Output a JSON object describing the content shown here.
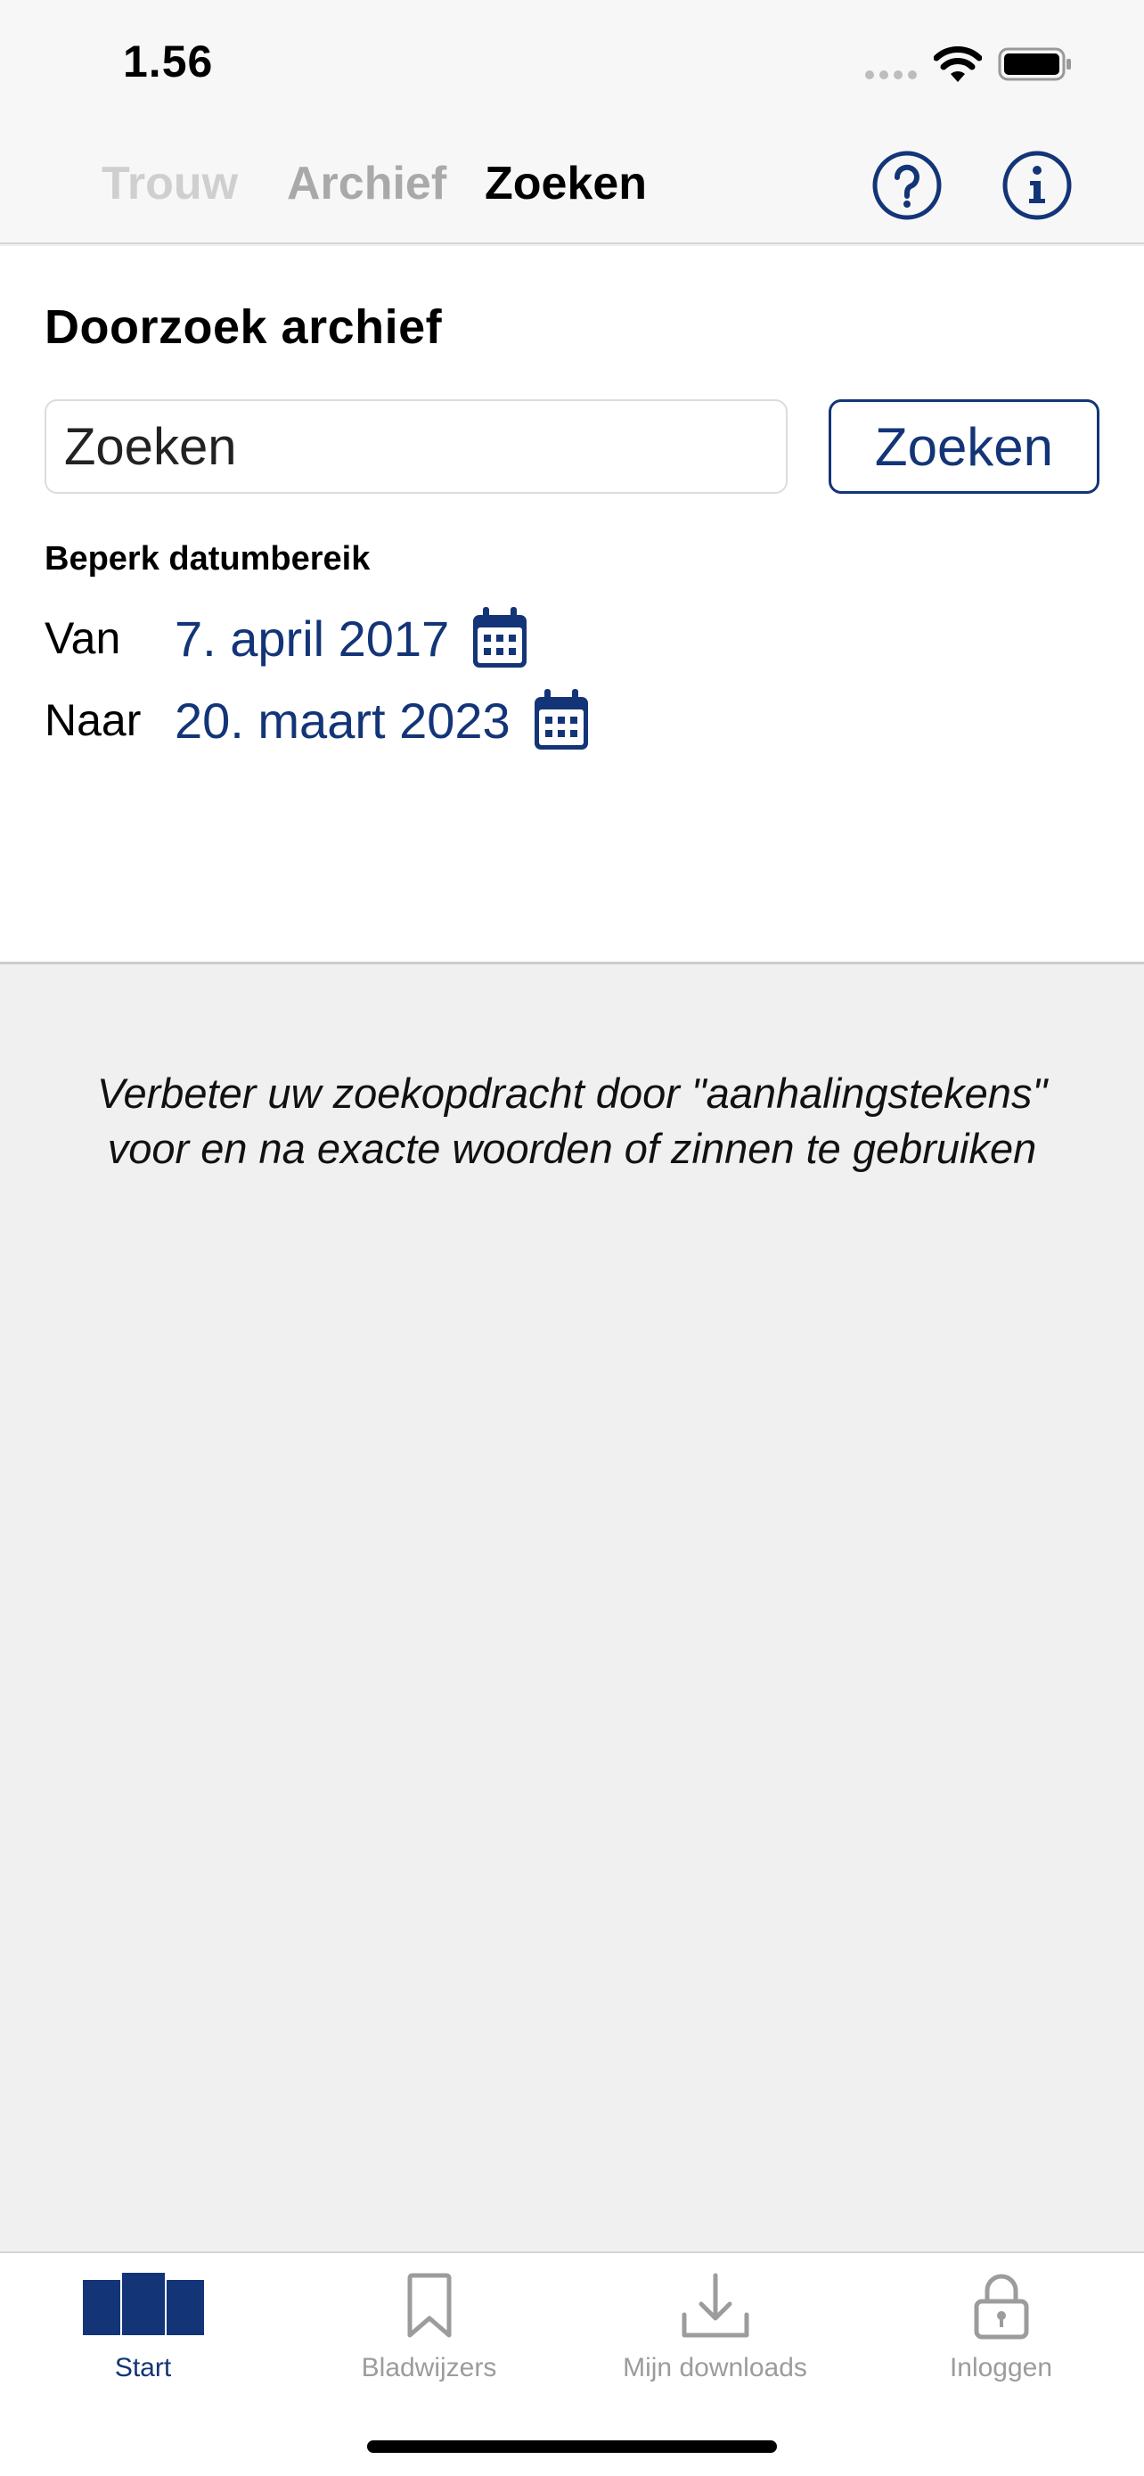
{
  "status_bar": {
    "time": "1.56"
  },
  "top_nav": {
    "tabs": [
      {
        "label": "Trouw"
      },
      {
        "label": "Archief"
      },
      {
        "label": "Zoeken"
      }
    ],
    "active_tab": "Zoeken",
    "actions": [
      "help-icon",
      "info-icon"
    ]
  },
  "search_panel": {
    "title": "Doorzoek archief",
    "input_placeholder": "Zoeken",
    "input_value": "",
    "button_label": "Zoeken",
    "range_label": "Beperk datumbereik",
    "from_label": "Van",
    "from_date": "7. april 2017",
    "to_label": "Naar",
    "to_date": "20. maart 2023"
  },
  "tip": {
    "line1": "Verbeter uw zoekopdracht door \"aanhalingstekens\"",
    "line2": "voor en na exacte woorden of zinnen te gebruiken"
  },
  "bottom_tabs": {
    "items": [
      {
        "label": "Start",
        "icon": "pages-icon"
      },
      {
        "label": "Bladwijzers",
        "icon": "bookmark-icon"
      },
      {
        "label": "Mijn downloads",
        "icon": "download-icon"
      },
      {
        "label": "Inloggen",
        "icon": "lock-icon"
      }
    ],
    "active": "Start"
  },
  "colors": {
    "accent": "#133578",
    "inactive": "#9c9c9c",
    "background": "#f0f0f0"
  }
}
